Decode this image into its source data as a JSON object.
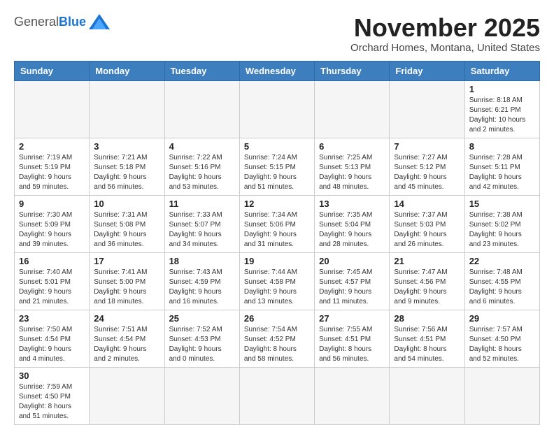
{
  "header": {
    "logo_general": "General",
    "logo_blue": "Blue",
    "month_title": "November 2025",
    "location": "Orchard Homes, Montana, United States"
  },
  "weekdays": [
    "Sunday",
    "Monday",
    "Tuesday",
    "Wednesday",
    "Thursday",
    "Friday",
    "Saturday"
  ],
  "weeks": [
    [
      {
        "day": "",
        "info": ""
      },
      {
        "day": "",
        "info": ""
      },
      {
        "day": "",
        "info": ""
      },
      {
        "day": "",
        "info": ""
      },
      {
        "day": "",
        "info": ""
      },
      {
        "day": "",
        "info": ""
      },
      {
        "day": "1",
        "info": "Sunrise: 8:18 AM\nSunset: 6:21 PM\nDaylight: 10 hours\nand 2 minutes."
      }
    ],
    [
      {
        "day": "2",
        "info": "Sunrise: 7:19 AM\nSunset: 5:19 PM\nDaylight: 9 hours\nand 59 minutes."
      },
      {
        "day": "3",
        "info": "Sunrise: 7:21 AM\nSunset: 5:18 PM\nDaylight: 9 hours\nand 56 minutes."
      },
      {
        "day": "4",
        "info": "Sunrise: 7:22 AM\nSunset: 5:16 PM\nDaylight: 9 hours\nand 53 minutes."
      },
      {
        "day": "5",
        "info": "Sunrise: 7:24 AM\nSunset: 5:15 PM\nDaylight: 9 hours\nand 51 minutes."
      },
      {
        "day": "6",
        "info": "Sunrise: 7:25 AM\nSunset: 5:13 PM\nDaylight: 9 hours\nand 48 minutes."
      },
      {
        "day": "7",
        "info": "Sunrise: 7:27 AM\nSunset: 5:12 PM\nDaylight: 9 hours\nand 45 minutes."
      },
      {
        "day": "8",
        "info": "Sunrise: 7:28 AM\nSunset: 5:11 PM\nDaylight: 9 hours\nand 42 minutes."
      }
    ],
    [
      {
        "day": "9",
        "info": "Sunrise: 7:30 AM\nSunset: 5:09 PM\nDaylight: 9 hours\nand 39 minutes."
      },
      {
        "day": "10",
        "info": "Sunrise: 7:31 AM\nSunset: 5:08 PM\nDaylight: 9 hours\nand 36 minutes."
      },
      {
        "day": "11",
        "info": "Sunrise: 7:33 AM\nSunset: 5:07 PM\nDaylight: 9 hours\nand 34 minutes."
      },
      {
        "day": "12",
        "info": "Sunrise: 7:34 AM\nSunset: 5:06 PM\nDaylight: 9 hours\nand 31 minutes."
      },
      {
        "day": "13",
        "info": "Sunrise: 7:35 AM\nSunset: 5:04 PM\nDaylight: 9 hours\nand 28 minutes."
      },
      {
        "day": "14",
        "info": "Sunrise: 7:37 AM\nSunset: 5:03 PM\nDaylight: 9 hours\nand 26 minutes."
      },
      {
        "day": "15",
        "info": "Sunrise: 7:38 AM\nSunset: 5:02 PM\nDaylight: 9 hours\nand 23 minutes."
      }
    ],
    [
      {
        "day": "16",
        "info": "Sunrise: 7:40 AM\nSunset: 5:01 PM\nDaylight: 9 hours\nand 21 minutes."
      },
      {
        "day": "17",
        "info": "Sunrise: 7:41 AM\nSunset: 5:00 PM\nDaylight: 9 hours\nand 18 minutes."
      },
      {
        "day": "18",
        "info": "Sunrise: 7:43 AM\nSunset: 4:59 PM\nDaylight: 9 hours\nand 16 minutes."
      },
      {
        "day": "19",
        "info": "Sunrise: 7:44 AM\nSunset: 4:58 PM\nDaylight: 9 hours\nand 13 minutes."
      },
      {
        "day": "20",
        "info": "Sunrise: 7:45 AM\nSunset: 4:57 PM\nDaylight: 9 hours\nand 11 minutes."
      },
      {
        "day": "21",
        "info": "Sunrise: 7:47 AM\nSunset: 4:56 PM\nDaylight: 9 hours\nand 9 minutes."
      },
      {
        "day": "22",
        "info": "Sunrise: 7:48 AM\nSunset: 4:55 PM\nDaylight: 9 hours\nand 6 minutes."
      }
    ],
    [
      {
        "day": "23",
        "info": "Sunrise: 7:50 AM\nSunset: 4:54 PM\nDaylight: 9 hours\nand 4 minutes."
      },
      {
        "day": "24",
        "info": "Sunrise: 7:51 AM\nSunset: 4:54 PM\nDaylight: 9 hours\nand 2 minutes."
      },
      {
        "day": "25",
        "info": "Sunrise: 7:52 AM\nSunset: 4:53 PM\nDaylight: 9 hours\nand 0 minutes."
      },
      {
        "day": "26",
        "info": "Sunrise: 7:54 AM\nSunset: 4:52 PM\nDaylight: 8 hours\nand 58 minutes."
      },
      {
        "day": "27",
        "info": "Sunrise: 7:55 AM\nSunset: 4:51 PM\nDaylight: 8 hours\nand 56 minutes."
      },
      {
        "day": "28",
        "info": "Sunrise: 7:56 AM\nSunset: 4:51 PM\nDaylight: 8 hours\nand 54 minutes."
      },
      {
        "day": "29",
        "info": "Sunrise: 7:57 AM\nSunset: 4:50 PM\nDaylight: 8 hours\nand 52 minutes."
      }
    ],
    [
      {
        "day": "30",
        "info": "Sunrise: 7:59 AM\nSunset: 4:50 PM\nDaylight: 8 hours\nand 51 minutes."
      },
      {
        "day": "",
        "info": ""
      },
      {
        "day": "",
        "info": ""
      },
      {
        "day": "",
        "info": ""
      },
      {
        "day": "",
        "info": ""
      },
      {
        "day": "",
        "info": ""
      },
      {
        "day": "",
        "info": ""
      }
    ]
  ]
}
